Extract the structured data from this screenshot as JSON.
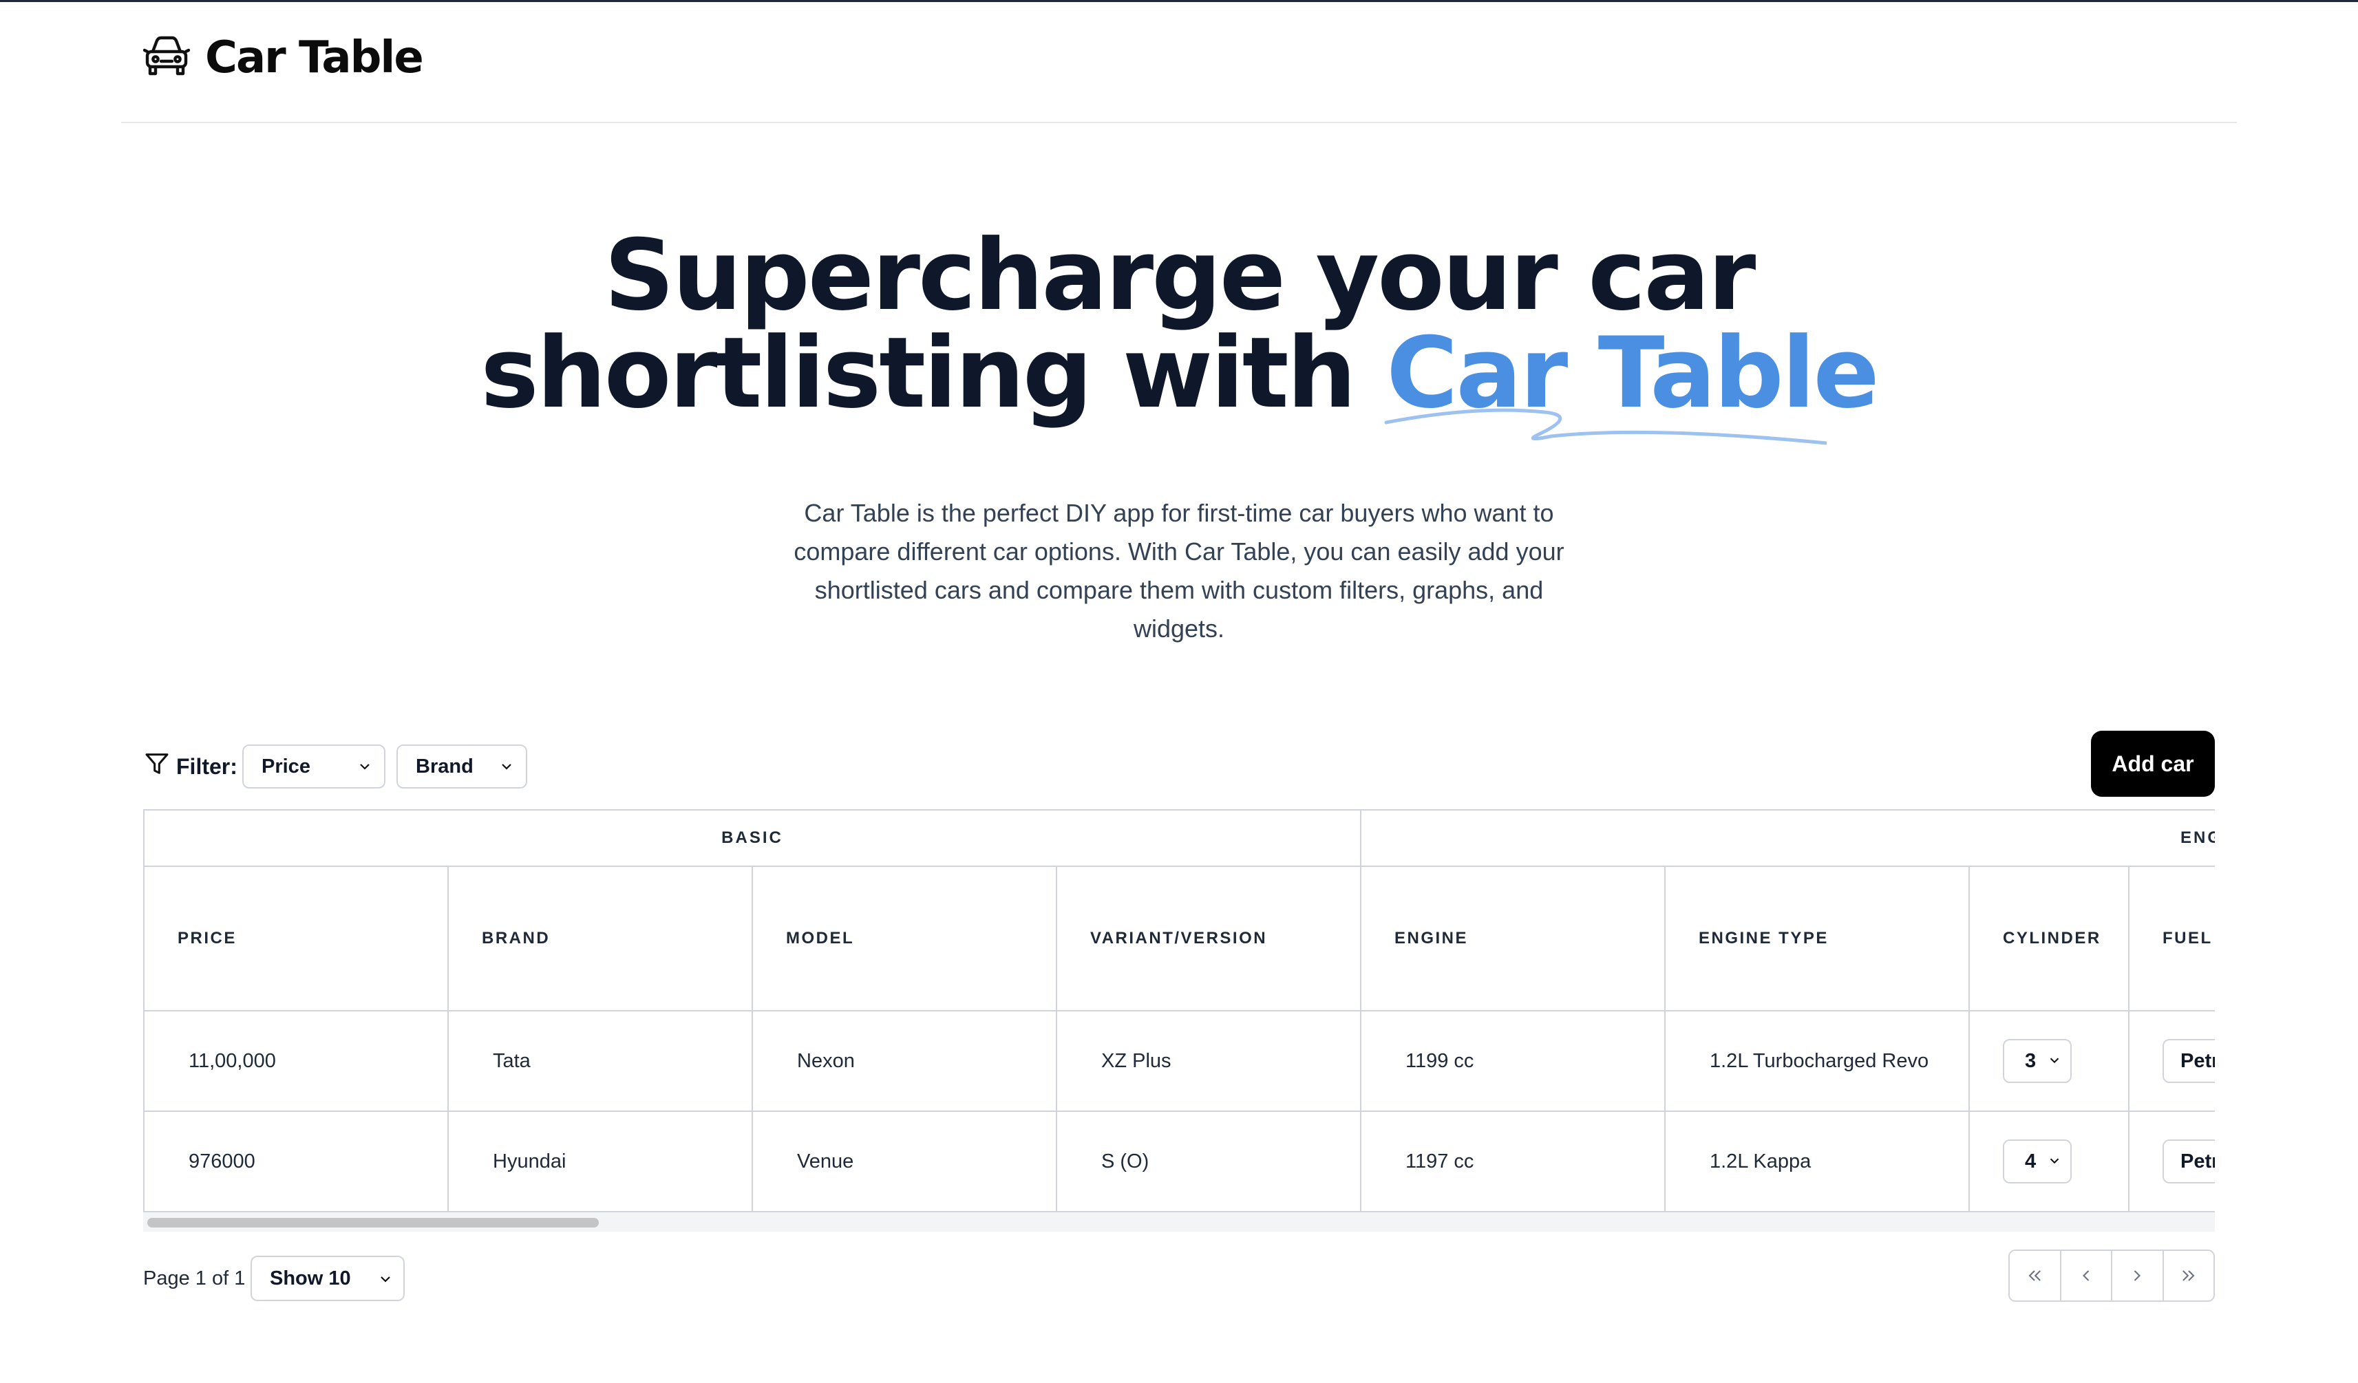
{
  "app": {
    "title": "Car Table"
  },
  "hero": {
    "title_line1": "Supercharge your car",
    "title_line2_prefix": "shortlisting with ",
    "title_accent": "Car Table",
    "description": "Car Table is the perfect DIY app for first-time car buyers who want to compare different car options. With Car Table, you can easily add your shortlisted cars and compare them with custom filters, graphs, and widgets."
  },
  "filter": {
    "label": "Filter:",
    "price_select": "Price",
    "brand_select": "Brand"
  },
  "actions": {
    "add_car": "Add car"
  },
  "table": {
    "groups": [
      "BASIC",
      "ENG"
    ],
    "columns": [
      "PRICE",
      "BRAND",
      "MODEL",
      "VARIANT/VERSION",
      "ENGINE",
      "ENGINE TYPE",
      "CYLINDER",
      "FUEL"
    ],
    "rows": [
      {
        "price": "11,00,000",
        "brand": "Tata",
        "model": "Nexon",
        "variant": "XZ Plus",
        "engine": "1199 cc",
        "engine_type": "1.2L Turbocharged Revo",
        "cylinder": "3",
        "fuel": "Petr"
      },
      {
        "price": "976000",
        "brand": "Hyundai",
        "model": "Venue",
        "variant": "S (O)",
        "engine": "1197 cc",
        "engine_type": "1.2L Kappa",
        "cylinder": "4",
        "fuel": "Petr"
      }
    ]
  },
  "pagination": {
    "page_info": "Page 1 of 1",
    "page_size": "Show 10"
  },
  "colors": {
    "accent": "#4a8fe2",
    "button_bg": "#000000",
    "border": "#d1d5db"
  },
  "icons": [
    "car-icon",
    "filter-icon",
    "chevron-down-icon",
    "first-page-icon",
    "prev-page-icon",
    "next-page-icon",
    "last-page-icon"
  ]
}
